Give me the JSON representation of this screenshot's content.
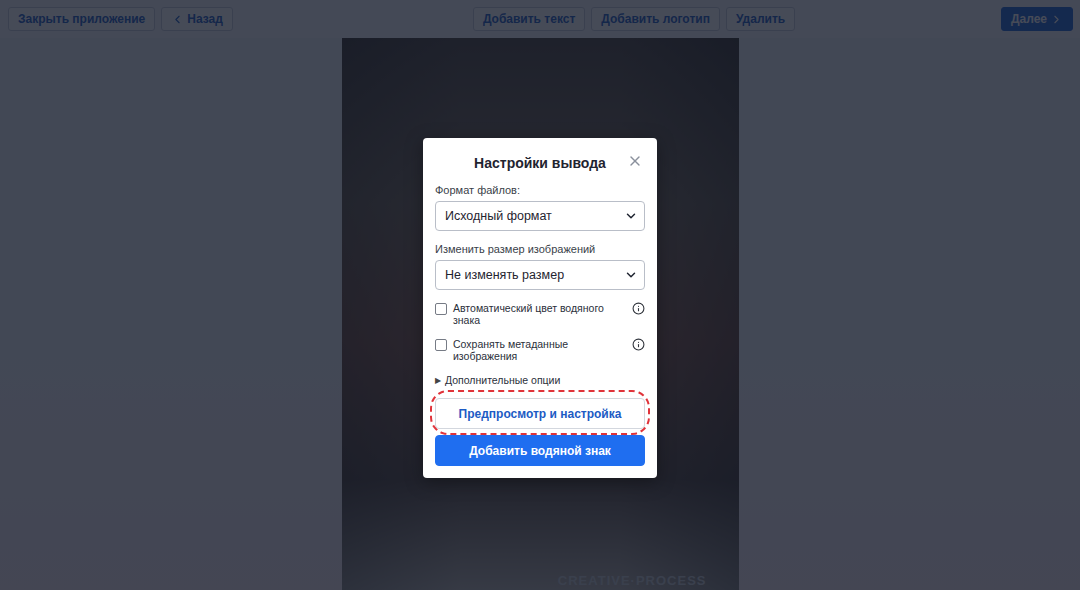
{
  "toolbar": {
    "left_buttons": [
      {
        "label": "Закрыть приложение",
        "kind": "plain"
      },
      {
        "label": "Назад",
        "kind": "back"
      }
    ],
    "center_buttons": [
      "Добавить текст",
      "Добавить логотип",
      "Удалить"
    ],
    "next_button": "Далее"
  },
  "photo": {
    "watermark": "CREATIVE·PROCESS"
  },
  "dialog": {
    "title": "Настройки вывода",
    "fields": [
      {
        "label": "Формат файлов:",
        "value": "Исходный формат"
      },
      {
        "label": "Изменить размер изображений",
        "value": "Не изменять размер"
      }
    ],
    "checkboxes": [
      {
        "label": "Автоматический цвет водяного знака",
        "checked": false
      },
      {
        "label": "Сохранять метаданные изображения",
        "checked": false
      }
    ],
    "advanced": {
      "icon": "▶",
      "label": "Дополнительные опции",
      "expanded": false
    },
    "preview_button": {
      "label": "Предпросмотр и настройка",
      "highlighted": true
    },
    "primary_button": "Добавить водяной знак"
  }
}
